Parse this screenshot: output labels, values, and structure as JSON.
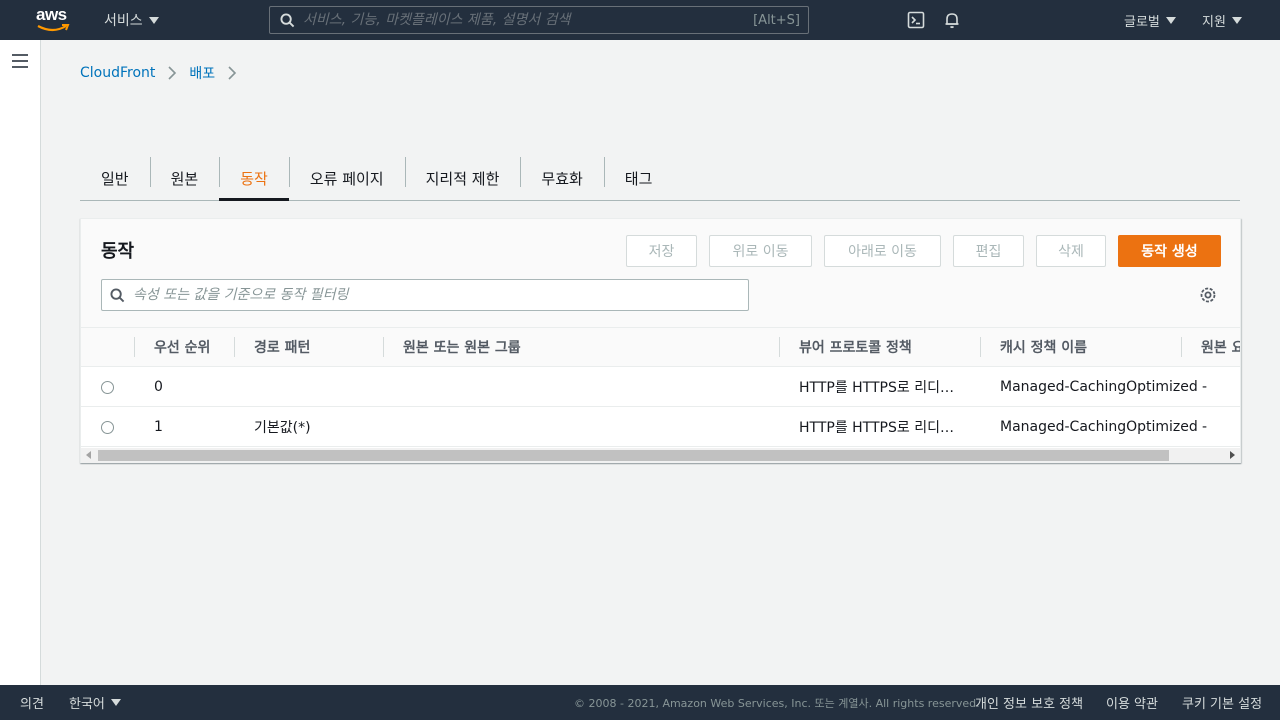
{
  "topnav": {
    "logo_text": "aws",
    "services_label": "서비스",
    "search_placeholder": "서비스, 기능, 마켓플레이스 제품, 설명서 검색",
    "search_shortcut": "[Alt+S]",
    "region_label": "글로벌",
    "support_label": "지원"
  },
  "breadcrumb": {
    "items": [
      "CloudFront",
      "배포"
    ]
  },
  "tabs": [
    {
      "label": "일반"
    },
    {
      "label": "원본"
    },
    {
      "label": "동작",
      "active": true
    },
    {
      "label": "오류 페이지"
    },
    {
      "label": "지리적 제한"
    },
    {
      "label": "무효화"
    },
    {
      "label": "태그"
    }
  ],
  "panel": {
    "title": "동작",
    "buttons": {
      "save": "저장",
      "move_up": "위로 이동",
      "move_down": "아래로 이동",
      "edit": "편집",
      "delete": "삭제",
      "create": "동작 생성"
    },
    "filter_placeholder": "속성 또는 값을 기준으로 동작 필터링"
  },
  "table": {
    "columns": [
      "우선 순위",
      "경로 패턴",
      "원본 또는 원본 그룹",
      "뷰어 프로토콜 정책",
      "캐시 정책 이름",
      "원본 요청 정책 이름"
    ],
    "rows": [
      {
        "priority": "0",
        "path": "",
        "origin": "",
        "viewer_policy": "HTTP를 HTTPS로 리디…",
        "cache_policy": "Managed-CachingOptimized",
        "origin_request": "-"
      },
      {
        "priority": "1",
        "path": "기본값(*)",
        "origin": "",
        "viewer_policy": "HTTP를 HTTPS로 리디…",
        "cache_policy": "Managed-CachingOptimized",
        "origin_request": "-"
      }
    ]
  },
  "footer": {
    "feedback": "의견",
    "language": "한국어",
    "copyright": "© 2008 - 2021, Amazon Web Services, Inc. 또는 계열사. All rights reserved.",
    "privacy": "개인 정보 보호 정책",
    "terms": "이용 약관",
    "cookies": "쿠키 기본 설정"
  },
  "colors": {
    "nav_bg": "#232f3e",
    "accent": "#ec7211",
    "link": "#0073bb"
  }
}
